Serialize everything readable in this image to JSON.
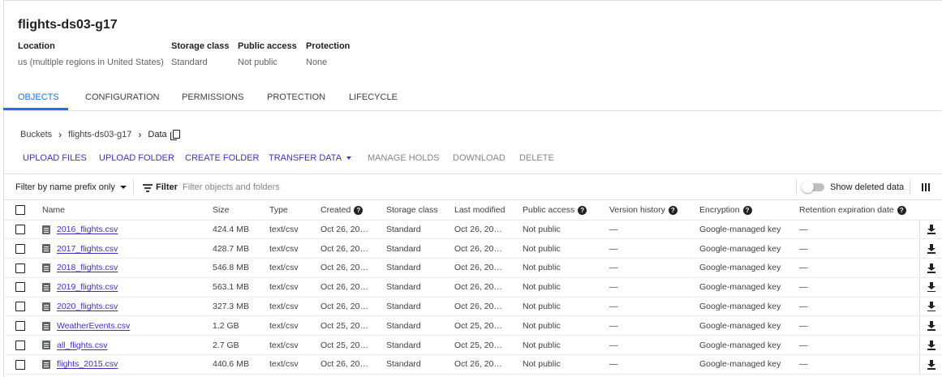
{
  "bucket": {
    "title": "flights-ds03-g17",
    "meta": [
      {
        "label": "Location",
        "value": "us (multiple regions in United States)"
      },
      {
        "label": "Storage class",
        "value": "Standard"
      },
      {
        "label": "Public access",
        "value": "Not public"
      },
      {
        "label": "Protection",
        "value": "None"
      }
    ]
  },
  "tabs": [
    {
      "label": "OBJECTS",
      "active": true
    },
    {
      "label": "CONFIGURATION",
      "active": false
    },
    {
      "label": "PERMISSIONS",
      "active": false
    },
    {
      "label": "PROTECTION",
      "active": false
    },
    {
      "label": "LIFECYCLE",
      "active": false
    }
  ],
  "breadcrumb": [
    "Buckets",
    "flights-ds03-g17",
    "Data"
  ],
  "actions": [
    {
      "label": "UPLOAD FILES",
      "enabled": true
    },
    {
      "label": "UPLOAD FOLDER",
      "enabled": true
    },
    {
      "label": "CREATE FOLDER",
      "enabled": true
    },
    {
      "label": "TRANSFER DATA",
      "enabled": true,
      "dropdown": true
    },
    {
      "label": "MANAGE HOLDS",
      "enabled": false
    },
    {
      "label": "DOWNLOAD",
      "enabled": false
    },
    {
      "label": "DELETE",
      "enabled": false
    }
  ],
  "filter": {
    "prefix_label": "Filter by name prefix only",
    "label": "Filter",
    "placeholder": "Filter objects and folders",
    "show_deleted_label": "Show deleted data",
    "show_deleted": false
  },
  "table": {
    "columns": [
      "Name",
      "Size",
      "Type",
      "Created",
      "Storage class",
      "Last modified",
      "Public access",
      "Version history",
      "Encryption",
      "Retention expiration date"
    ],
    "rows": [
      {
        "name": "2016_flights.csv",
        "size": "424.4 MB",
        "type": "text/csv",
        "created": "Oct 26, 20…",
        "storage": "Standard",
        "modified": "Oct 26, 20…",
        "public": "Not public",
        "version": "—",
        "encryption": "Google-managed key",
        "retention": "—"
      },
      {
        "name": "2017_flights.csv",
        "size": "428.7 MB",
        "type": "text/csv",
        "created": "Oct 26, 20…",
        "storage": "Standard",
        "modified": "Oct 26, 20…",
        "public": "Not public",
        "version": "—",
        "encryption": "Google-managed key",
        "retention": "—"
      },
      {
        "name": "2018_flights.csv",
        "size": "546.8 MB",
        "type": "text/csv",
        "created": "Oct 26, 20…",
        "storage": "Standard",
        "modified": "Oct 26, 20…",
        "public": "Not public",
        "version": "—",
        "encryption": "Google-managed key",
        "retention": "—"
      },
      {
        "name": "2019_flights.csv",
        "size": "563.1 MB",
        "type": "text/csv",
        "created": "Oct 26, 20…",
        "storage": "Standard",
        "modified": "Oct 26, 20…",
        "public": "Not public",
        "version": "—",
        "encryption": "Google-managed key",
        "retention": "—"
      },
      {
        "name": "2020_flights.csv",
        "size": "327.3 MB",
        "type": "text/csv",
        "created": "Oct 26, 20…",
        "storage": "Standard",
        "modified": "Oct 26, 20…",
        "public": "Not public",
        "version": "—",
        "encryption": "Google-managed key",
        "retention": "—"
      },
      {
        "name": "WeatherEvents.csv",
        "size": "1.2 GB",
        "type": "text/csv",
        "created": "Oct 25, 20…",
        "storage": "Standard",
        "modified": "Oct 25, 20…",
        "public": "Not public",
        "version": "—",
        "encryption": "Google-managed key",
        "retention": "—"
      },
      {
        "name": "all_flights.csv",
        "size": "2.7 GB",
        "type": "text/csv",
        "created": "Oct 25, 20…",
        "storage": "Standard",
        "modified": "Oct 25, 20…",
        "public": "Not public",
        "version": "—",
        "encryption": "Google-managed key",
        "retention": "—"
      },
      {
        "name": "flights_2015.csv",
        "size": "440.6 MB",
        "type": "text/csv",
        "created": "Oct 26, 20…",
        "storage": "Standard",
        "modified": "Oct 26, 20…",
        "public": "Not public",
        "version": "—",
        "encryption": "Google-managed key",
        "retention": "—"
      }
    ]
  },
  "colors": {
    "accent": "#1a73e8",
    "link": "#3f2fc4",
    "disabled": "#80868b"
  }
}
